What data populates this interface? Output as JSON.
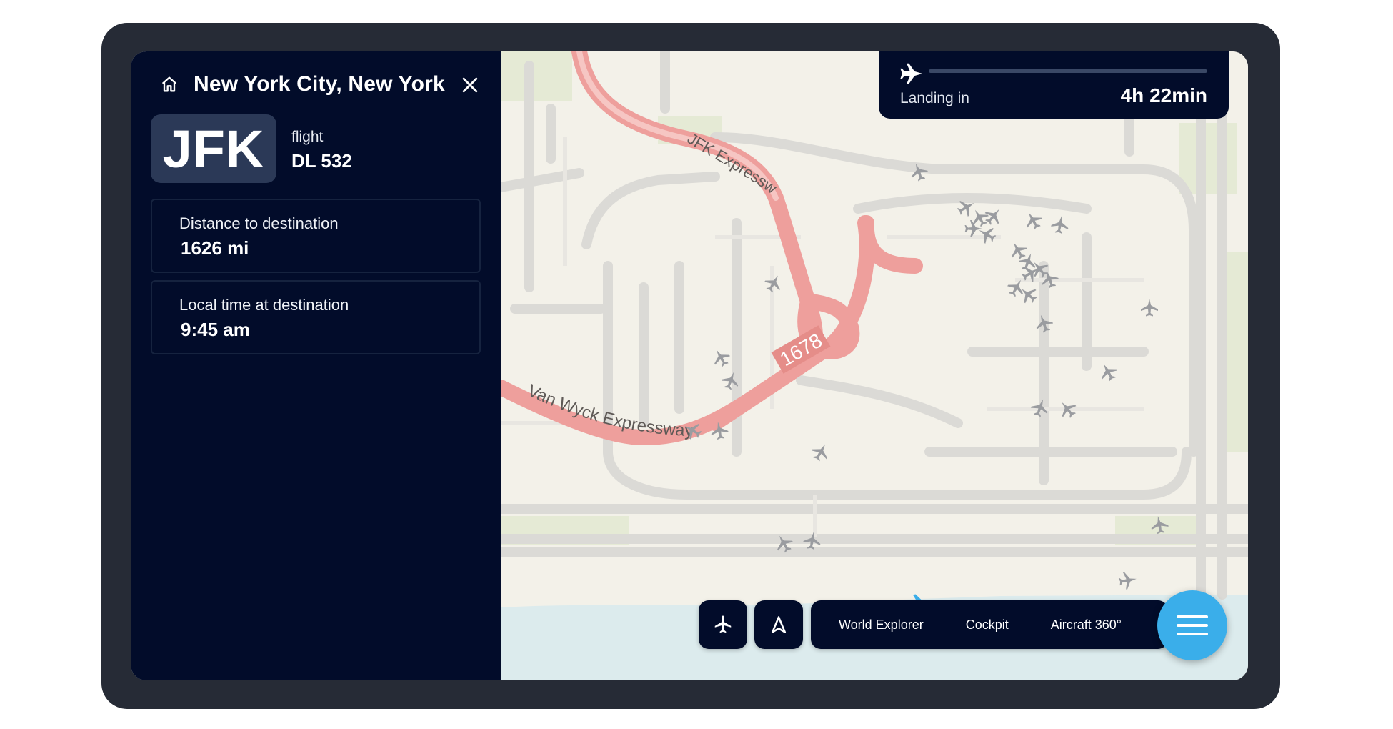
{
  "panel": {
    "city": "New York City, New York",
    "airport_code": "JFK",
    "flight_label": "flight",
    "flight_number": "DL 532",
    "distance_label": "Distance to destination",
    "distance_value": "1626 mi",
    "time_label": "Local time at destination",
    "time_value": "9:45 am"
  },
  "landing": {
    "label": "Landing in",
    "time": "4h 22min",
    "progress_fraction": 0.0
  },
  "map": {
    "road_labels": [
      "JFK Expressway",
      "Van Wyck Expresswayy",
      "1678"
    ]
  },
  "bottom_nav": {
    "modes": [
      "World Explorer",
      "Cockpit",
      "Aircraft 360°"
    ]
  },
  "colors": {
    "panel_bg": "#020c2a",
    "device_frame": "#262b36",
    "accent": "#3aaeea",
    "highway": "#ee9f9c",
    "map_bg": "#f3f1e9",
    "water": "#dcebed",
    "aircraft_other": "#9a9ca0",
    "aircraft_self": "#3aaeea"
  },
  "icons": [
    "home-icon",
    "close-icon",
    "plane-icon",
    "navigation-arrow-icon",
    "menu-icon"
  ]
}
